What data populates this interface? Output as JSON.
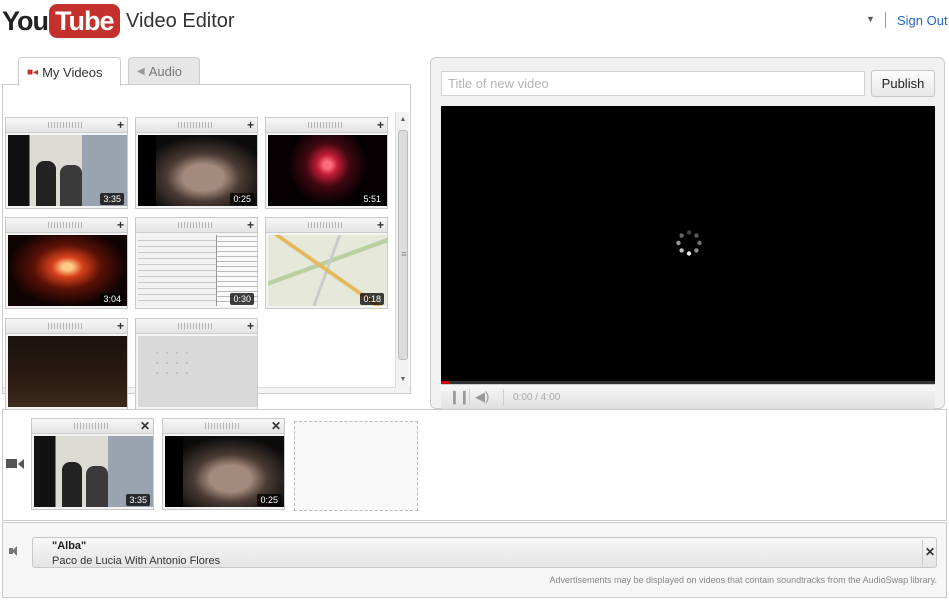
{
  "header": {
    "logo_you": "You",
    "logo_tube": "Tube",
    "app_title": "Video Editor",
    "user_menu_caret": "▼",
    "signout_label": "Sign Out"
  },
  "tabs": [
    {
      "label": "My Videos",
      "icon": "video-camera-icon",
      "active": true
    },
    {
      "label": "Audio",
      "icon": "speaker-icon",
      "active": false
    }
  ],
  "library": {
    "clips": [
      {
        "duration": "3:35",
        "art": "t1"
      },
      {
        "duration": "0:25",
        "art": "t2"
      },
      {
        "duration": "5:51",
        "art": "t3"
      },
      {
        "duration": "3:04",
        "art": "t4"
      },
      {
        "duration": "0:30",
        "art": "t5"
      },
      {
        "duration": "0:18",
        "art": "t6"
      },
      {
        "duration": "",
        "art": "t7"
      },
      {
        "duration": "",
        "art": "t8"
      }
    ],
    "add_label": "+"
  },
  "preview": {
    "title_placeholder": "Title of new video",
    "title_value": "",
    "publish_label": "Publish",
    "time_display": "0:00 / 4:00",
    "progress_fraction": 0.0
  },
  "timeline": {
    "clips": [
      {
        "duration": "3:35",
        "art": "t1"
      },
      {
        "duration": "0:25",
        "art": "t2"
      }
    ],
    "remove_label": "✕"
  },
  "audio": {
    "song_title": "\"Alba\"",
    "artist": "Paco de Lucia With Antonio Flores",
    "remove_label": "✕",
    "ad_note": "Advertisements may be displayed on videos that contain soundtracks from the AudioSwap library."
  },
  "colors": {
    "brand_red": "#c4302b",
    "link_blue": "#2466c4"
  }
}
